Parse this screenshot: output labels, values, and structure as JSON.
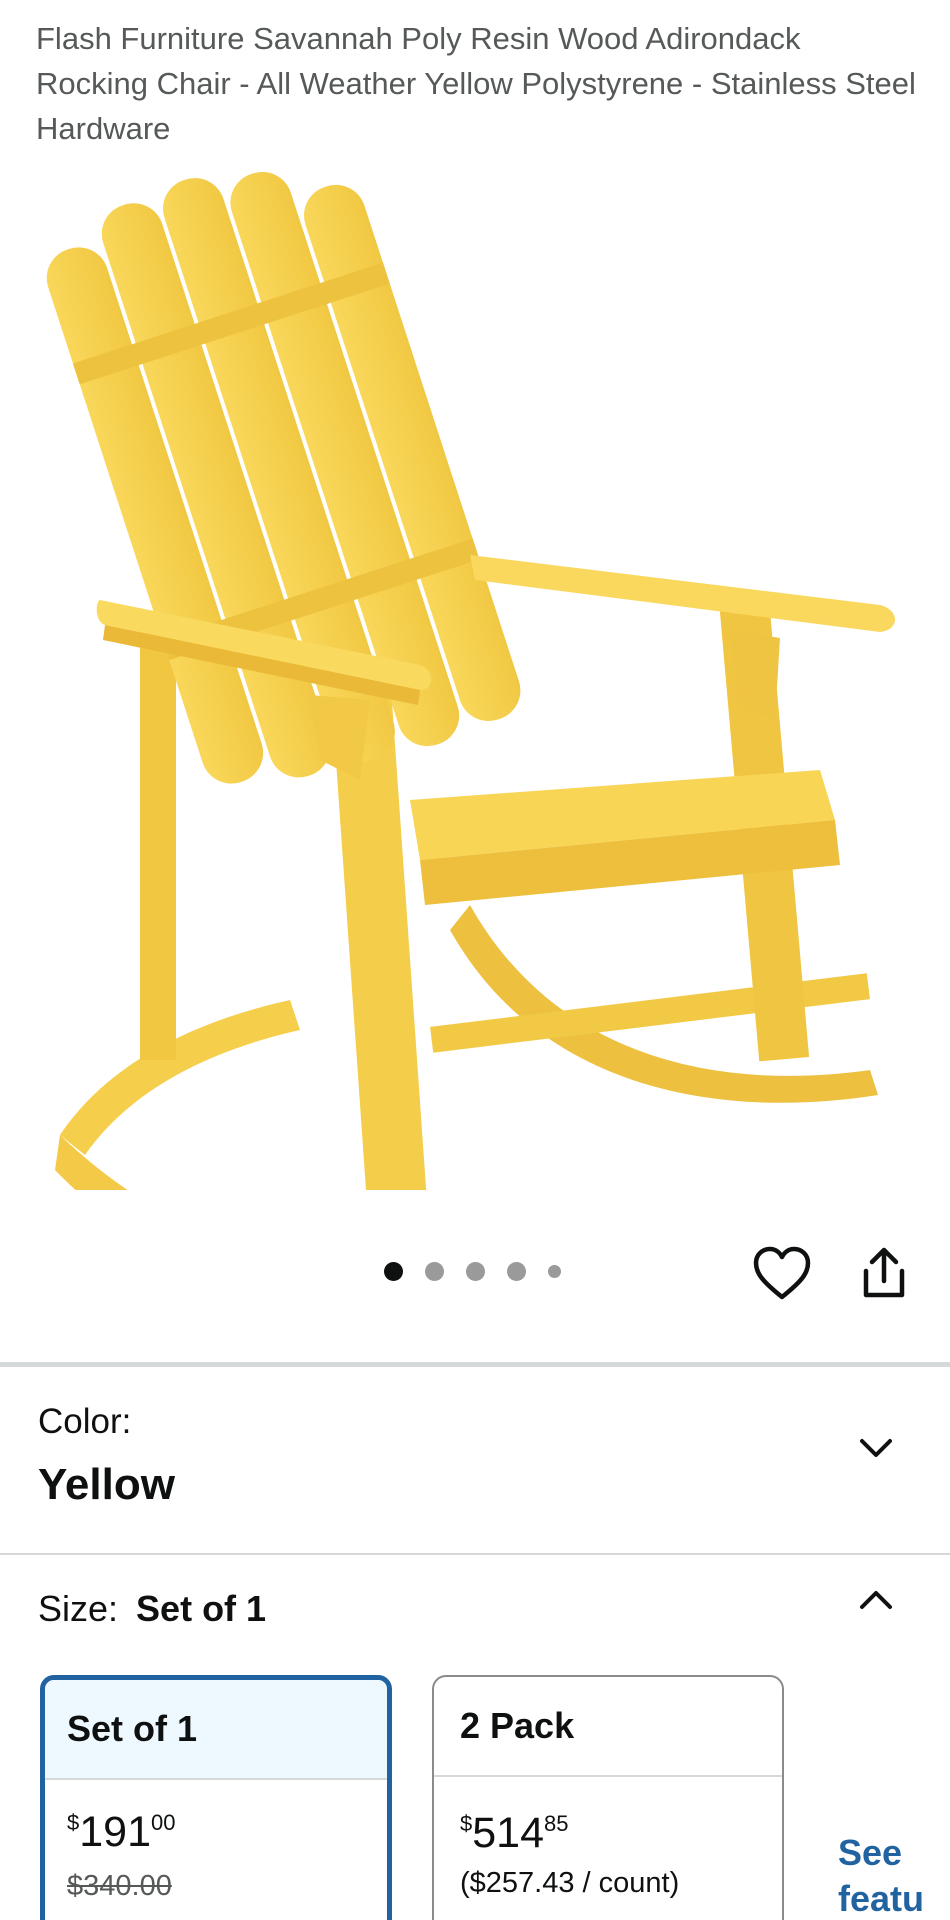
{
  "product": {
    "title": "Flash Furniture Savannah Poly Resin Wood Adirondack Rocking Chair - All Weather Yellow Polystyrene - Stainless Steel Hardware"
  },
  "gallery": {
    "image_count": 5,
    "active_index": 0,
    "wishlist_icon": "heart-icon",
    "share_icon": "share-icon"
  },
  "color": {
    "label": "Color:",
    "value": "Yellow",
    "expander_icon": "chevron-down-icon"
  },
  "size": {
    "label": "Size:",
    "selected": "Set of 1",
    "expander_icon": "chevron-up-icon",
    "options": [
      {
        "name": "Set of 1",
        "currency": "$",
        "price_whole": "191",
        "price_fraction": "00",
        "list_price": "$340.00"
      },
      {
        "name": "2 Pack",
        "currency": "$",
        "price_whole": "514",
        "price_fraction": "85",
        "unit_price": "($257.43 / count)"
      }
    ],
    "see_more_line1": "See",
    "see_more_line2": "featu"
  },
  "colors": {
    "chair_yellow": "#f7d04e",
    "chair_shadow": "#e8b93a",
    "link_blue": "#2162a1",
    "selected_bg": "#edf8ff"
  }
}
